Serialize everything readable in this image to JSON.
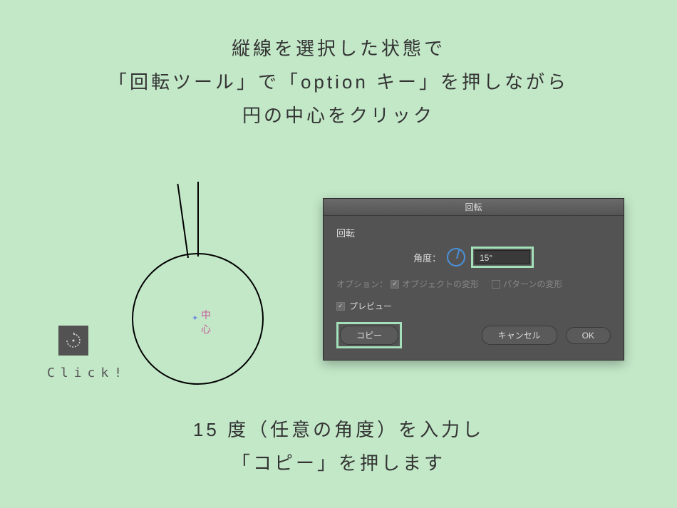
{
  "instructions": {
    "line1": "縦線を選択した状態で",
    "line2": "「回転ツール」で「option キー」を押しながら",
    "line3": "円の中心をクリック",
    "line4": "15 度（任意の角度）を入力し",
    "line5": "「コピー」を押します"
  },
  "click_label": "Click!",
  "center_label": "中心",
  "dialog": {
    "title": "回転",
    "section": "回転",
    "angle_label": "角度：",
    "angle_value": "15°",
    "options_label": "オプション：",
    "transform_objects": "オブジェクトの変形",
    "transform_patterns": "パターンの変形",
    "preview": "プレビュー",
    "copy_btn": "コピー",
    "cancel_btn": "キャンセル",
    "ok_btn": "OK"
  }
}
